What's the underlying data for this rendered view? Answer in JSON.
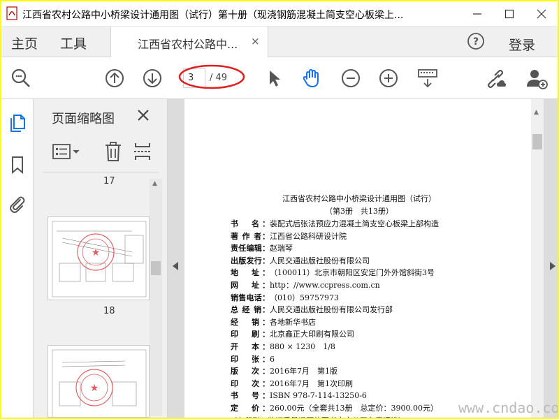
{
  "window": {
    "title": "江西省农村公路中小桥梁设计通用图（试行）第十册（现浇钢筋混凝土简支空心板梁上...",
    "min_icon": "minimize-icon",
    "max_icon": "maximize-icon",
    "close_icon": "close-icon"
  },
  "menu": {
    "home": "主页",
    "tools": "工具",
    "doc_tab": "江西省农村公路中...",
    "doc_tab_close": "×",
    "login": "登录"
  },
  "toolbar": {
    "page_current": "3",
    "page_total": "/ 49"
  },
  "thumbnails": {
    "title": "页面缩略图",
    "pages": [
      "17",
      "18"
    ]
  },
  "document": {
    "title_line1": "江西省农村公路中小桥梁设计通用图（试行）",
    "title_line2": "（第3册　共13册）",
    "rows": [
      {
        "label": "书　名：",
        "value": "装配式后张法预应力混凝土简支空心板梁上部构造"
      },
      {
        "label": "著 作 者：",
        "value": "江西省公路科研设计院"
      },
      {
        "label": "责任编辑：",
        "value": "赵瑞琴"
      },
      {
        "label": "出版发行：",
        "value": "人民交通出版社股份有限公司"
      },
      {
        "label": "地　址：",
        "value": "（100011）北京市朝阳区安定门外外馆斜街3号"
      },
      {
        "label": "网　址：",
        "value": "http：//www.ccpress.com.cn"
      },
      {
        "label": "销售电话：",
        "value": "（010）59757973"
      },
      {
        "label": "总 经 销：",
        "value": "人民交通出版社股份有限公司发行部"
      },
      {
        "label": "经　销：",
        "value": "各地新华书店"
      },
      {
        "label": "印　刷：",
        "value": "北京鑫正大印刷有限公司"
      },
      {
        "label": "开　本：",
        "value": "880 × 1230　1/8"
      },
      {
        "label": "印　张：",
        "value": "6"
      },
      {
        "label": "版　次：",
        "value": "2016年7月　第1版"
      },
      {
        "label": "印　次：",
        "value": "2016年7月　第1次印刷"
      },
      {
        "label": "书　号：",
        "value": "ISBN 978-7-114-13250-6"
      },
      {
        "label": "定　价：",
        "value": "260.00元（全套共13册　总定价：3900.00元）"
      },
      {
        "label": "",
        "value": "（有印刷、装订质量问题的图书由本公司负责调换）"
      }
    ]
  },
  "watermark": "www.cndao.com",
  "colors": {
    "accent_blue": "#1473e6",
    "annotation_red": "#e02020",
    "highlight_border": "#ffff00"
  }
}
